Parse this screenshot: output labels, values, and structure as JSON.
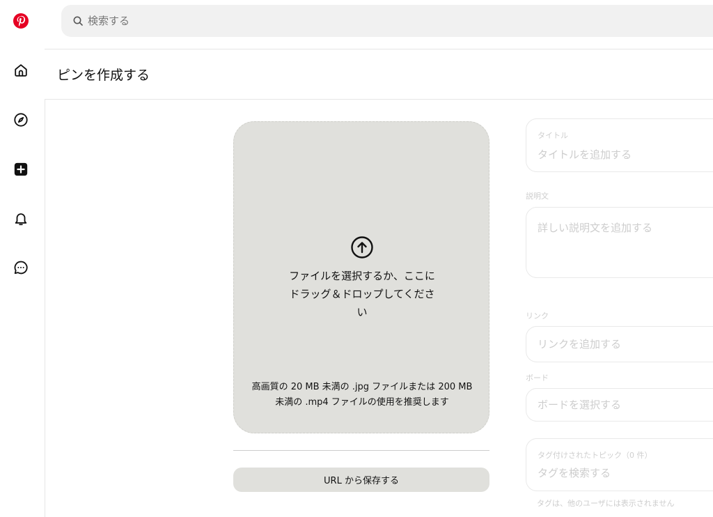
{
  "search": {
    "placeholder": "検索する"
  },
  "header": {
    "title": "ピンを作成する"
  },
  "upload": {
    "main_text": "ファイルを選択するか、ここにドラッグ＆ドロップしてください",
    "recommendation": "高画質の 20 MB 未満の .jpg ファイルまたは 200 MB 未満の .mp4 ファイルの使用を推奨します"
  },
  "url_button": {
    "label": "URL から保存する"
  },
  "form": {
    "title": {
      "label": "タイトル",
      "placeholder": "タイトルを追加する"
    },
    "description": {
      "label": "説明文",
      "placeholder": "詳しい説明文を追加する"
    },
    "link": {
      "label": "リンク",
      "placeholder": "リンクを追加する"
    },
    "board": {
      "label": "ボード",
      "placeholder": "ボードを選択する"
    },
    "tags": {
      "label": "タグ付けされたトピック（0 件）",
      "placeholder": "タグを検索する",
      "note": "タグは、他のユーザには表示されません"
    }
  },
  "colors": {
    "brand": "#e60023",
    "panel": "#e0e0dc",
    "search_bg": "#f1f1f1"
  },
  "icons": [
    "pinterest-logo-icon",
    "home-icon",
    "explore-compass-icon",
    "create-plus-icon",
    "notifications-bell-icon",
    "messages-icon",
    "search-icon",
    "upload-arrow-icon"
  ]
}
